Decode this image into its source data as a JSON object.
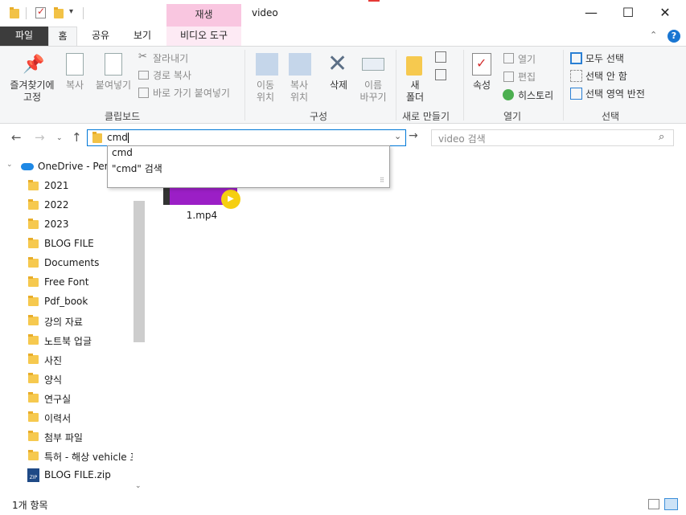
{
  "window": {
    "title": "video",
    "context_tab": "재생",
    "controls": {
      "minimize": "—",
      "maximize": "☐",
      "close": "✕"
    }
  },
  "tabs": [
    "파일",
    "홈",
    "공유",
    "보기",
    "비디오 도구"
  ],
  "ribbon": {
    "clipboard": {
      "pin": "즐겨찾기에",
      "pin2": "고정",
      "copy": "복사",
      "paste": "붙여넣기",
      "cut": "잘라내기",
      "copy_path": "경로 복사",
      "paste_shortcut": "바로 가기 붙여넣기",
      "group": "클립보드"
    },
    "organize": {
      "move_to": "이동",
      "move_to2": "위치",
      "copy_to": "복사",
      "copy_to2": "위치",
      "delete": "삭제",
      "rename": "이름",
      "rename2": "바꾸기",
      "group": "구성"
    },
    "new": {
      "new_folder": "새",
      "new_folder2": "폴더",
      "group": "새로 만들기"
    },
    "open": {
      "properties": "속성",
      "open": "열기",
      "edit": "편집",
      "history": "히스토리",
      "group": "열기"
    },
    "select": {
      "select_all": "모두 선택",
      "select_none": "선택 안 함",
      "invert": "선택 영역 반전",
      "group": "선택"
    }
  },
  "address": {
    "value": "cmd",
    "search_placeholder": "video 검색",
    "suggestions": [
      "cmd",
      "\"cmd\" 검색"
    ]
  },
  "tree": {
    "onedrive": "OneDrive - Pers",
    "items": [
      "2021",
      "2022",
      "2023",
      "BLOG FILE",
      "Documents",
      "Free Font",
      "Pdf_book",
      "강의 자료",
      "노트북 업글",
      "사진",
      "양식",
      "연구실",
      "이력서",
      "첨부 파일",
      "특허 - 해상 vehicle 프"
    ],
    "zip": "BLOG FILE.zip",
    "zip_badge": "ZIP"
  },
  "files": [
    {
      "name": "1.mp4"
    }
  ],
  "status": {
    "count": "1개 항목"
  },
  "colors": {
    "accent": "#0078d7",
    "context_tab": "#f9c6e0",
    "folder": "#f6c94f",
    "video_purple": "#9b1fc6",
    "play": "#f6cf10"
  }
}
